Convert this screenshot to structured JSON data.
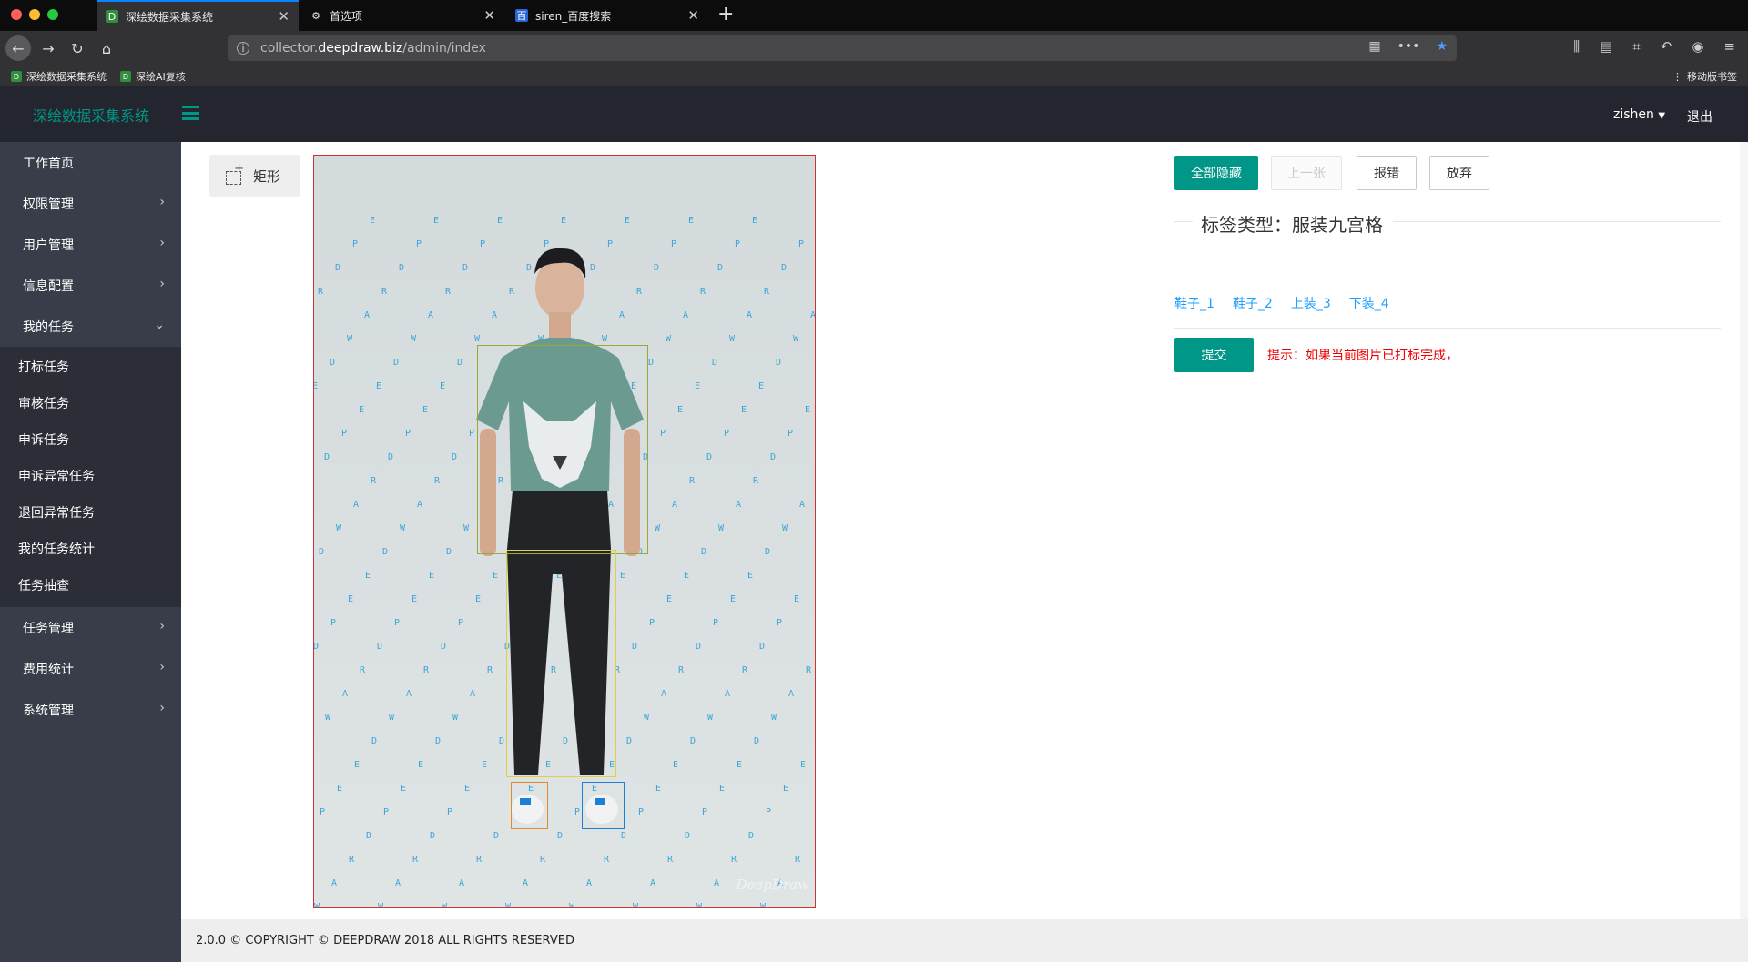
{
  "browser": {
    "tabs": [
      {
        "title": "深绘数据采集系统",
        "active": true
      },
      {
        "title": "首选项",
        "active": false
      },
      {
        "title": "siren_百度搜索",
        "active": false
      }
    ],
    "url_prefix": "collector.",
    "url_domain": "deepdraw.biz",
    "url_path": "/admin/index",
    "bookmarks": [
      "深绘数据采集系统",
      "深绘AI复核"
    ],
    "mobile_bookmarks": "移动版书签"
  },
  "app": {
    "brand": "深绘数据采集系统",
    "user": "zishen",
    "logout": "退出",
    "accent_color": "#009688"
  },
  "sidebar": {
    "items": [
      {
        "label": "工作首页"
      },
      {
        "label": "权限管理"
      },
      {
        "label": "用户管理"
      },
      {
        "label": "信息配置"
      },
      {
        "label": "我的任务"
      }
    ],
    "subitems": [
      "打标任务",
      "审核任务",
      "申诉任务",
      "申诉异常任务",
      "退回异常任务",
      "我的任务统计",
      "任务抽查"
    ],
    "items_after": [
      {
        "label": "任务管理"
      },
      {
        "label": "费用统计"
      },
      {
        "label": "系统管理"
      }
    ]
  },
  "tools": {
    "rect_label": "矩形"
  },
  "canvas": {
    "watermark": "DeepDraw"
  },
  "actions": {
    "hide_all": "全部隐藏",
    "prev": "上一张",
    "report": "报错",
    "abandon": "放弃"
  },
  "label_type": "标签类型：服装九宫格",
  "tags": [
    "鞋子_1",
    "鞋子_2",
    "上装_3",
    "下装_4"
  ],
  "submit": "提交",
  "hint": "提示：如果当前图片已打标完成，",
  "footer": "2.0.0 © COPYRIGHT © DEEPDRAW 2018 ALL RIGHTS RESERVED"
}
